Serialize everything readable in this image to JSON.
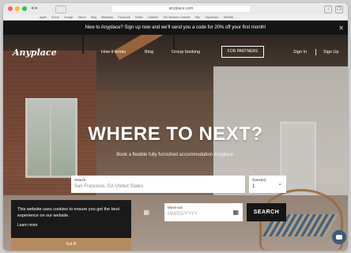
{
  "browser": {
    "url": "anyplace.com",
    "bookmarks": [
      "Apple",
      "iCloud",
      "Google",
      "Yahoo!",
      "Bing",
      "Wikipedia",
      "Facebook",
      "Twitter",
      "LinkedIn",
      "The Weather Channel",
      "Yelp",
      "TripAdvisor",
      "WebMD"
    ]
  },
  "promo": {
    "text": "New to Anyplace? Sign up now and we'll send you a code for 20% off your first month!",
    "close_icon": "close-icon"
  },
  "header": {
    "logo": "Anyplace",
    "nav": [
      "How it works",
      "Blog",
      "Group booking"
    ],
    "partners": "FOR PARTNERS",
    "sign_in": "Sign In",
    "sign_up": "Sign Up"
  },
  "hero": {
    "headline": "WHERE TO NEXT?",
    "tagline": "Book a flexible fully furnished accommodation Anyplace."
  },
  "search": {
    "label": "Search",
    "placeholder": "San Francisco, CA United States",
    "guests_label": "Guest(s)",
    "guests_value": "1",
    "checkout_label": "Move-out",
    "checkout_placeholder": "MM/DD/YYYY",
    "button": "SEARCH"
  },
  "cookie": {
    "text": "This website uses cookies to ensure you get the best experience on our website.",
    "learn_more": "Learn more",
    "button": "Got it!"
  },
  "colors": {
    "promo_bg": "#141414",
    "search_button": "#151515",
    "cookie_bg": "#1a1a1a",
    "gotit_bg": "#b58a5d",
    "chat_bg": "#3b5a7c"
  }
}
